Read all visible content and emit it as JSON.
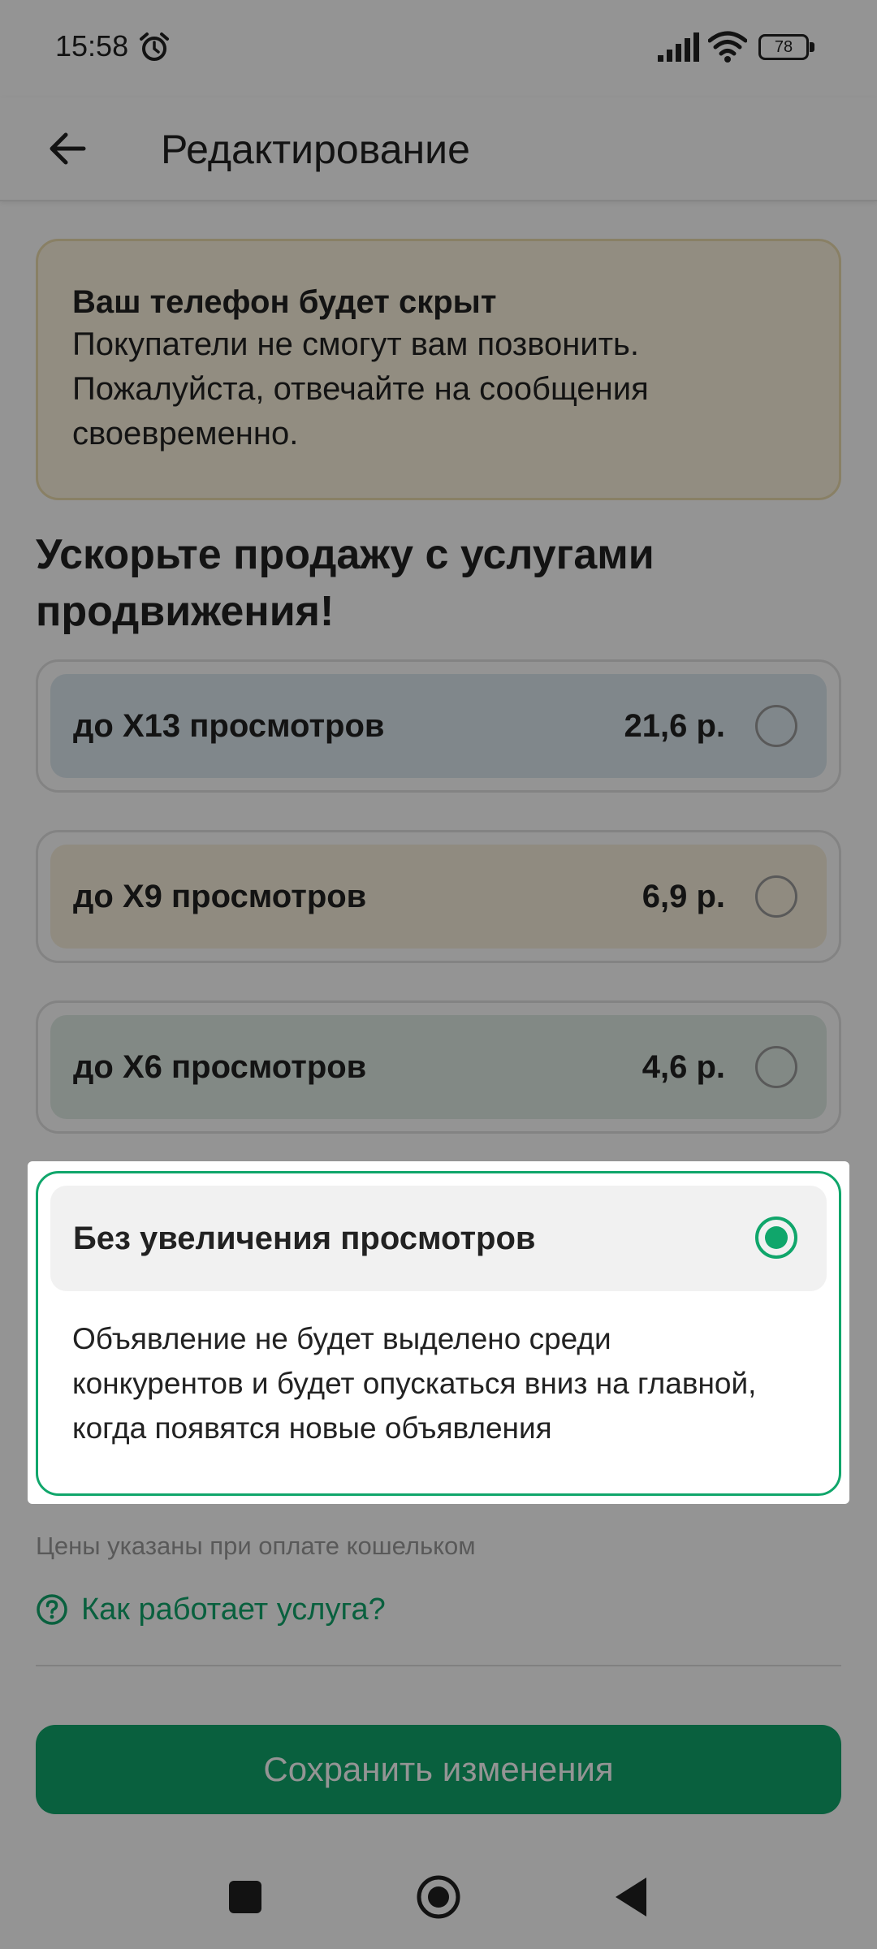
{
  "status_bar": {
    "time": "15:58",
    "battery": "78"
  },
  "app_bar": {
    "title": "Редактирование"
  },
  "warning": {
    "title": "Ваш телефон будет скрыт",
    "lines": [
      "Покупатели не смогут вам позвонить.",
      "Пожалуйста, отвечайте на сообщения",
      "своевременно."
    ]
  },
  "promo": {
    "heading_lines": [
      "Ускорьте продажу с услугами",
      "продвижения!"
    ],
    "options": [
      {
        "label": "до X13 просмотров",
        "price": "21,6 р.",
        "selected": false,
        "color": "#dce8f0"
      },
      {
        "label": "до X9 просмотров",
        "price": "6,9 р.",
        "selected": false,
        "color": "#f8f0dc"
      },
      {
        "label": "до X6 просмотров",
        "price": "4,6 р.",
        "selected": false,
        "color": "#e0ece6"
      }
    ],
    "selected_option": {
      "label": "Без увеличения просмотров",
      "selected": true,
      "description_lines": [
        "Объявление не будет выделено среди",
        "конкурентов и будет опускаться вниз на главной,",
        "когда появятся новые объявления"
      ]
    }
  },
  "footer": {
    "prices_note": "Цены указаны при оплате кошельком",
    "help_link": "Как работает услуга?",
    "save_button": "Сохранить изменения"
  },
  "colors": {
    "accent": "#10a66b",
    "warning_bg": "#fbf3df"
  }
}
